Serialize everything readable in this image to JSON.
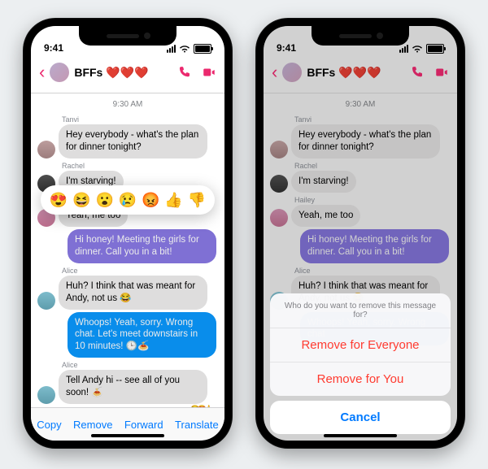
{
  "status": {
    "time": "9:41"
  },
  "chat": {
    "title": "BFFs",
    "hearts": "❤️❤️❤️",
    "timestamp": "9:30 AM",
    "messages": {
      "m0": {
        "sender": "Tanvi",
        "text": "Hey everybody - what's the plan for dinner tonight?"
      },
      "m1": {
        "sender": "Rachel",
        "text": "I'm starving!"
      },
      "m2": {
        "sender": "Hailey",
        "text": "Yeah, me too"
      },
      "m3": {
        "text": "Hi honey! Meeting the girls for dinner. Call you in a bit!"
      },
      "m4": {
        "sender": "Alice",
        "text": "Huh? I think that was meant for Andy, not us 😂"
      },
      "m5": {
        "text": "Whoops! Yeah, sorry. Wrong chat. Let's meet downstairs in 10 minutes! 🕒🍝"
      },
      "m5b": {
        "text": "Whoops! Yeah, sorry. Wrong chat"
      },
      "m6": {
        "sender": "Alice",
        "text": "Tell Andy hi -- see all of you soon! 🍝"
      }
    }
  },
  "reactions": {
    "r0": "😍",
    "r1": "😆",
    "r2": "😮",
    "r3": "😢",
    "r4": "😡",
    "r5": "👍",
    "r6": "👎"
  },
  "actions": {
    "copy": "Copy",
    "remove": "Remove",
    "forward": "Forward",
    "translate": "Translate"
  },
  "sheet": {
    "prompt": "Who do you want to remove this message for?",
    "everyone": "Remove for Everyone",
    "you": "Remove for You",
    "cancel": "Cancel"
  }
}
